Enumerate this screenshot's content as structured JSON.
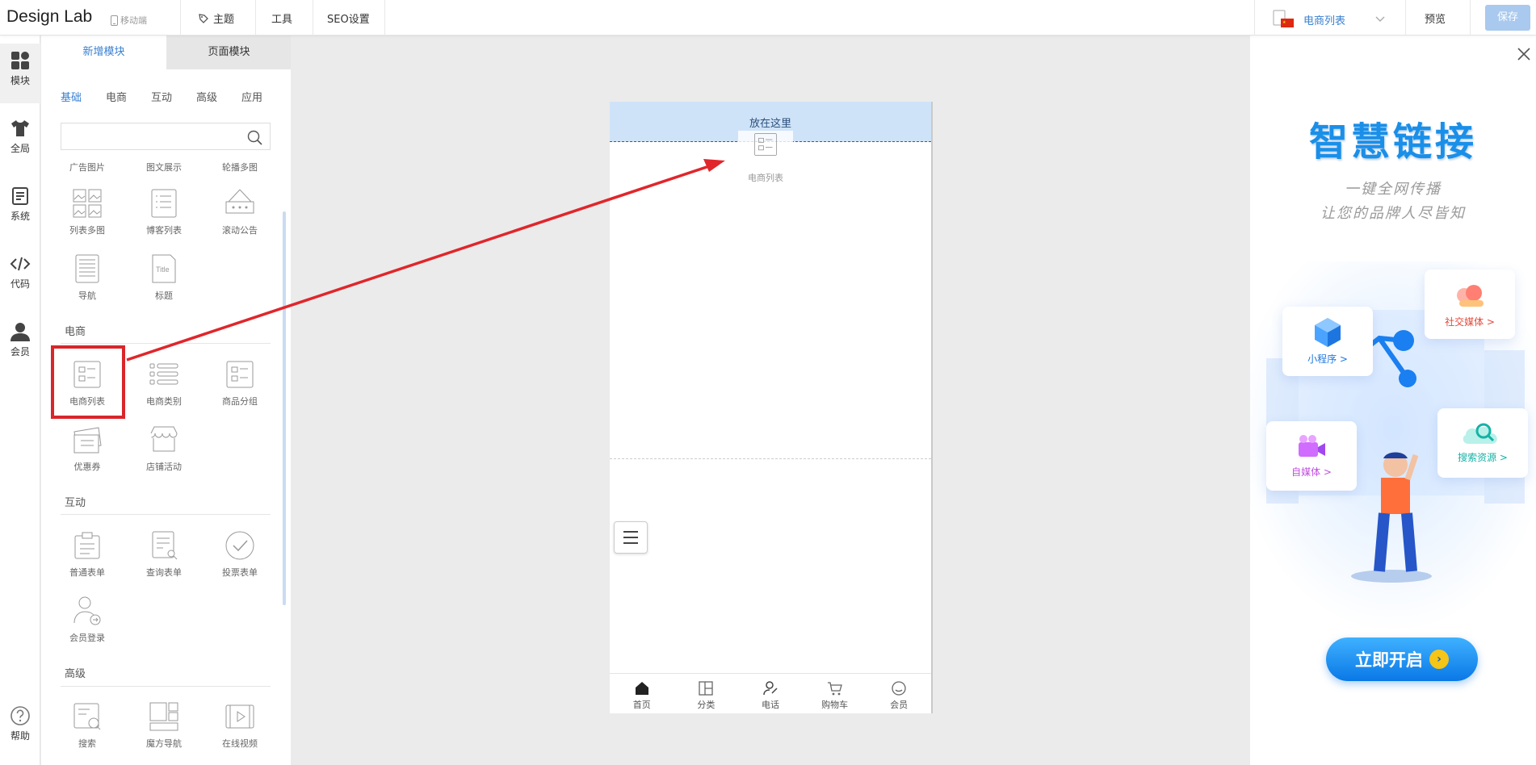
{
  "topbar": {
    "logo": "Design Lab",
    "mobile_label": "移动端",
    "nav": [
      "主题",
      "工具",
      "SEO设置"
    ],
    "language": "电商列表",
    "preview_label": "预览",
    "save_label": "保存"
  },
  "rail": {
    "items": [
      "模块",
      "全局",
      "系统",
      "代码",
      "会员"
    ],
    "help": "帮助"
  },
  "panel": {
    "tabs": [
      "新增模块",
      "页面模块"
    ],
    "categories": [
      "基础",
      "电商",
      "互动",
      "高级",
      "应用"
    ],
    "search_placeholder": "",
    "partial_row": [
      "广告图片",
      "图文展示",
      "轮播多图"
    ],
    "basic_items": [
      "列表多图",
      "博客列表",
      "滚动公告",
      "导航",
      "标题"
    ],
    "ecommerce_heading": "电商",
    "ecommerce_items": [
      "电商列表",
      "电商类别",
      "商品分组",
      "优惠券",
      "店铺活动"
    ],
    "interaction_heading": "互动",
    "interaction_items": [
      "普通表单",
      "查询表单",
      "投票表单",
      "会员登录"
    ],
    "advanced_heading": "高级",
    "advanced_items": [
      "搜索",
      "魔方导航",
      "在线视频"
    ]
  },
  "phone": {
    "drop_label": "放在这里",
    "dragged_label": "电商列表",
    "tabs": [
      "首页",
      "分类",
      "电话",
      "购物车",
      "会员"
    ]
  },
  "ad": {
    "title": "智慧链接",
    "subtitle1": "一键全网传播",
    "subtitle2": "让您的品牌人尽皆知",
    "cards": [
      "小程序 >",
      "社交媒体 >",
      "自媒体 >",
      "搜索资源 >"
    ],
    "cta": "立即开启"
  },
  "colors": {
    "accent": "#3a80d0",
    "highlight": "#d8262b",
    "drop_zone": "#cfe3f8"
  }
}
